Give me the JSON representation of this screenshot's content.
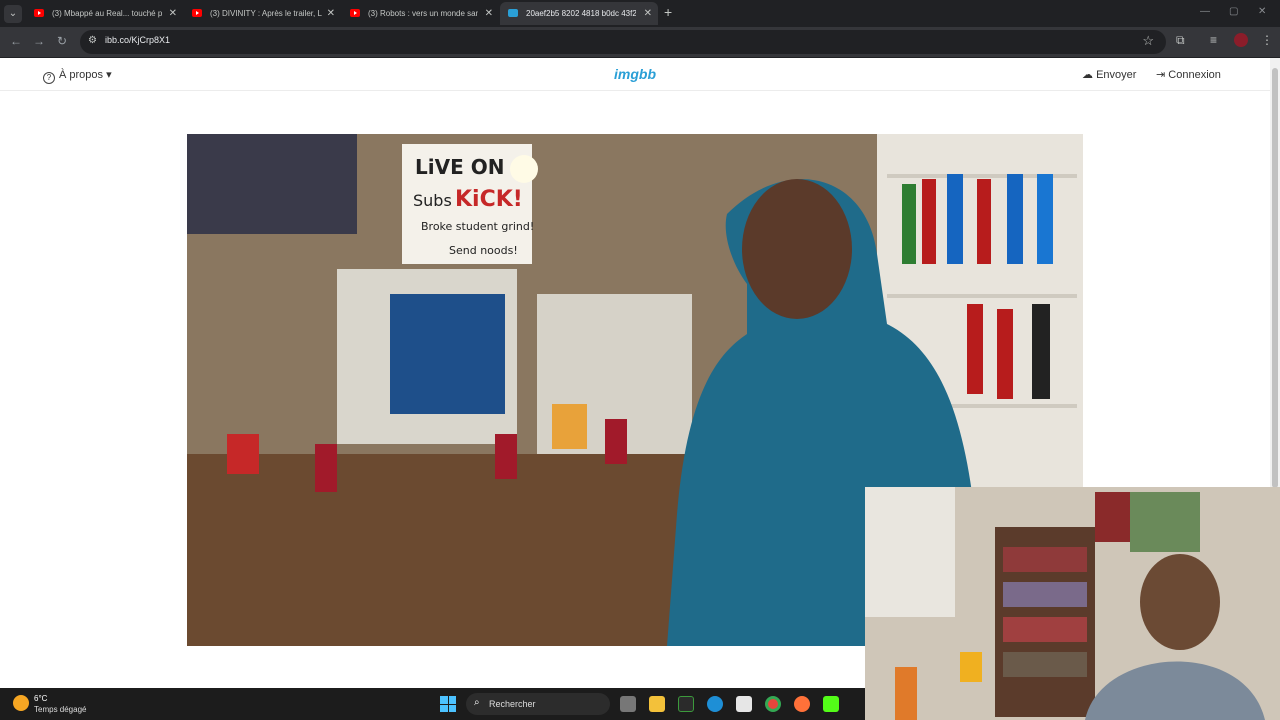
{
  "browser": {
    "tabs": [
      {
        "label": "(3) Mbappé au Real... touché p"
      },
      {
        "label": "(3) DIVINITY : Après le trailer, L"
      },
      {
        "label": "(3) Robots : vers un monde san"
      },
      {
        "label": "20aef2b5 8202 4818 b0dc 43f2"
      }
    ],
    "url": "ibb.co/KjCrp8X1"
  },
  "site": {
    "about_label": "À propos",
    "logo_text": "imgbb",
    "upload_label": "Envoyer",
    "login_label": "Connexion"
  },
  "image_text": {
    "sign_line1": "LiVE ON",
    "sign_line2": "Subs",
    "sign_line3": "KiCK!",
    "sign_line4": "Broke student grind!",
    "sign_line5": "Send noods!"
  },
  "taskbar": {
    "temperature": "6°C",
    "weather": "Temps dégagé",
    "search_placeholder": "Rechercher"
  },
  "colors": {
    "brand": "#2a9fd6",
    "browser_bg": "#202124",
    "toolbar_bg": "#35363a"
  }
}
